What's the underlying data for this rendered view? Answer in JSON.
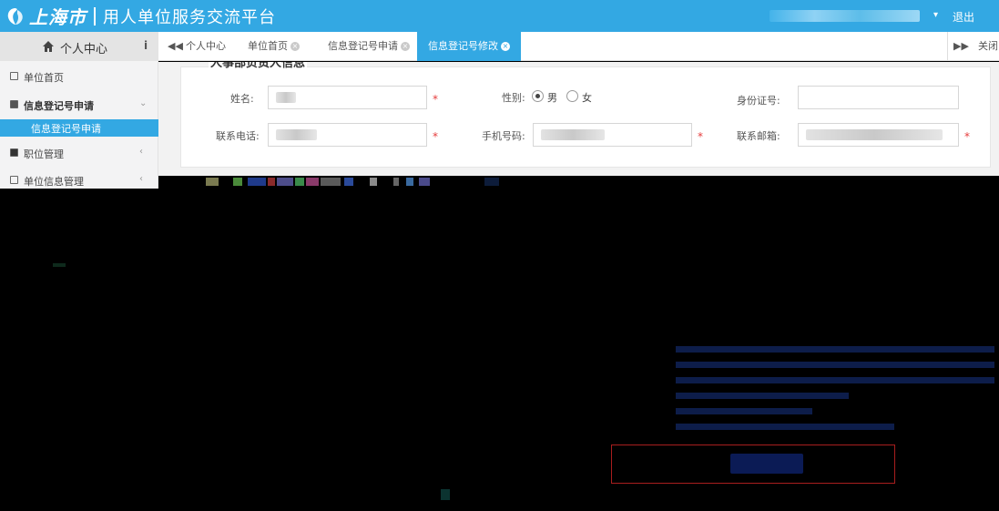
{
  "header": {
    "logo_city": "上海市",
    "title": "用人单位服务交流平台",
    "logout": "退出",
    "caret": "▾",
    "brand_color": "#33a8e3"
  },
  "sidebar_head": {
    "label": "个人中心",
    "info": "i"
  },
  "tabs": {
    "nav_left": "◀◀",
    "nav_right": "▶▶",
    "close_all": "关闭",
    "items": [
      {
        "label": "个人中心",
        "closable": false
      },
      {
        "label": "单位首页",
        "closable": true
      },
      {
        "label": "信息登记号申请",
        "closable": true
      },
      {
        "label": "信息登记号修改",
        "closable": true,
        "active": true
      }
    ],
    "close_glyph": "×"
  },
  "sidebar": {
    "items": [
      {
        "label": "单位首页",
        "icon": "square-icon"
      },
      {
        "label": "信息登记号申请",
        "icon": "book-icon",
        "arrow": "⌄"
      },
      {
        "label": "职位管理",
        "icon": "checkbox-icon",
        "arrow": "‹"
      },
      {
        "label": "单位信息管理",
        "icon": "list-icon",
        "arrow": "‹"
      }
    ],
    "sub_item": "信息登记号申请"
  },
  "form": {
    "legend": "人事部负责人信息",
    "name_label": "姓名:",
    "gender_label": "性别:",
    "male": "男",
    "female": "女",
    "gender_selected": "男",
    "id_label": "身份证号:",
    "phone_label": "联系电话:",
    "mobile_label": "手机号码:",
    "email_label": "联系邮箱:",
    "required_mark": "*"
  },
  "dark_region": {
    "left_text_1": " ",
    "left_text_2": " ",
    "hint": " "
  }
}
